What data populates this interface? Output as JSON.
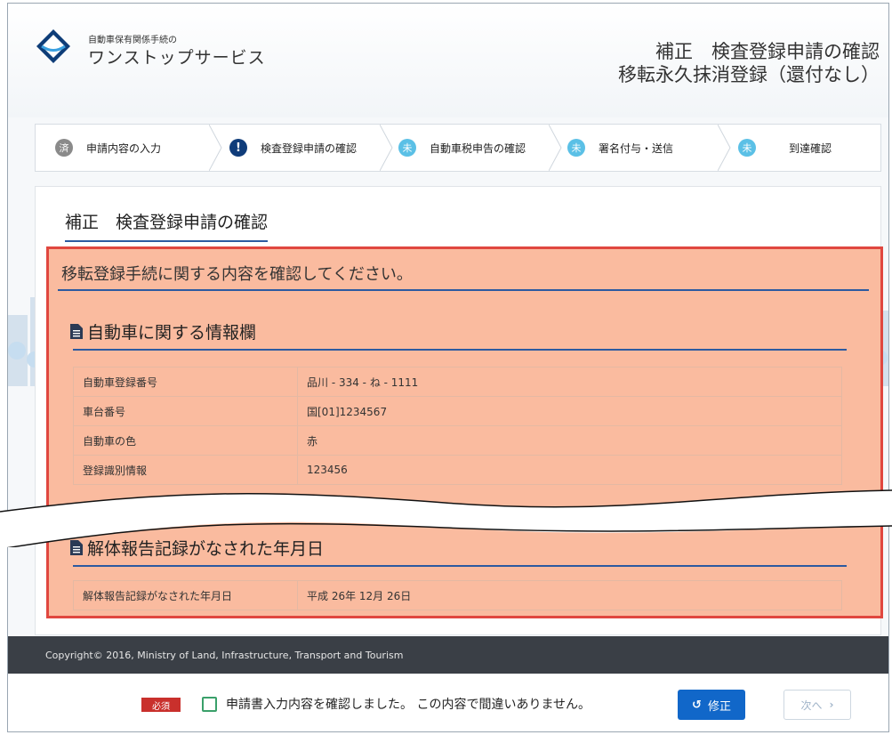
{
  "header": {
    "logo_small": "自動車保有関係手続の",
    "logo_big": "ワンストップサービス",
    "title_line1": "補正　検査登録申請の確認",
    "title_line2": "移転永久抹消登録（還付なし）"
  },
  "stepper": {
    "steps": [
      {
        "badge": "済",
        "label": "申請内容の入力",
        "state": "done"
      },
      {
        "badge": "!",
        "label": "検査登録申請の確認",
        "state": "current"
      },
      {
        "badge": "未",
        "label": "自動車税申告の確認",
        "state": "todo"
      },
      {
        "badge": "未",
        "label": "署名付与・送信",
        "state": "todo"
      },
      {
        "badge": "未",
        "label": "到達確認",
        "state": "todo"
      }
    ]
  },
  "main": {
    "section_heading": "補正　検査登録申請の確認",
    "confirm_message": "移転登録手続に関する内容を確認してください。",
    "vehicle_block": {
      "title": "自動車に関する情報欄",
      "rows": [
        {
          "key": "自動車登録番号",
          "value": "品川 - 334 - ね - 1111"
        },
        {
          "key": "車台番号",
          "value": "国[01]1234567"
        },
        {
          "key": "自動車の色",
          "value": "赤"
        },
        {
          "key": "登録識別情報",
          "value": "123456"
        }
      ]
    },
    "disassembly_block": {
      "title": "解体報告記録がなされた年月日",
      "rows": [
        {
          "key": "解体報告記録がなされた年月日",
          "value": "平成 26年 12月 26日"
        }
      ]
    }
  },
  "footer": {
    "copyright": "Copyright© 2016, Ministry of Land, Infrastructure, Transport and Tourism"
  },
  "action_bar": {
    "required_label": "必須",
    "agree_label": "申請書入力内容を確認しました。 この内容で間違いありません。",
    "fix_label": "修正",
    "next_label": "次へ"
  },
  "colors": {
    "accent": "#2c5aa0",
    "highlight_fill": "#f8a884",
    "highlight_border": "#e0473f",
    "fix_button": "#1167c9",
    "required_badge": "#c9302c"
  }
}
